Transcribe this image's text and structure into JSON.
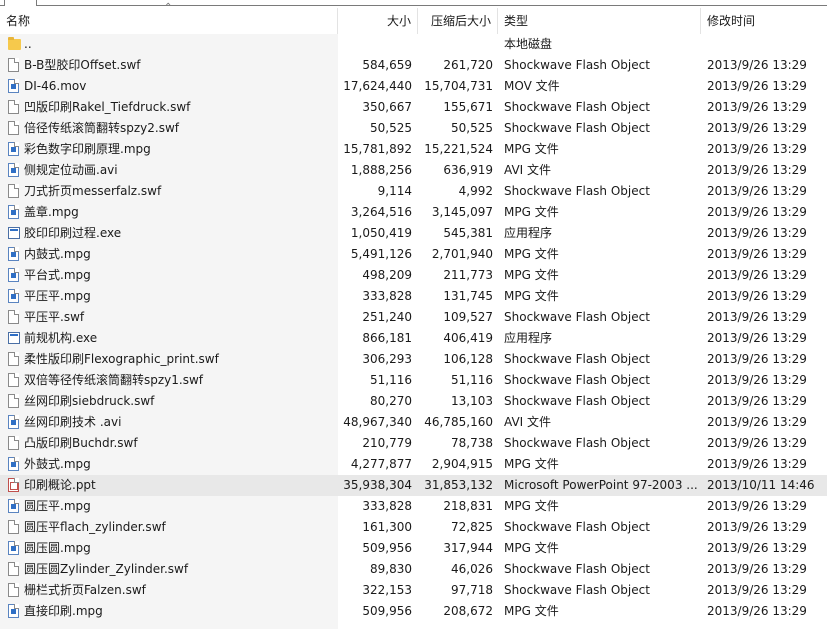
{
  "columns": {
    "name": "名称",
    "size": "大小",
    "compressed": "压缩后大小",
    "type": "类型",
    "modified": "修改时间"
  },
  "rows": [
    {
      "name": "..",
      "size": "",
      "compressed": "",
      "type": "本地磁盘",
      "modified": "",
      "icon": "folder-icon"
    },
    {
      "name": "B-B型胶印Offset.swf",
      "size": "584,659",
      "compressed": "261,720",
      "type": "Shockwave Flash Object",
      "modified": "2013/9/26 13:29",
      "icon": "file-icon"
    },
    {
      "name": "DI-46.mov",
      "size": "17,624,440",
      "compressed": "15,704,731",
      "type": "MOV 文件",
      "modified": "2013/9/26 13:29",
      "icon": "video-file-icon"
    },
    {
      "name": "凹版印刷Rakel_Tiefdruck.swf",
      "size": "350,667",
      "compressed": "155,671",
      "type": "Shockwave Flash Object",
      "modified": "2013/9/26 13:29",
      "icon": "file-icon"
    },
    {
      "name": "倍径传纸滚筒翻转spzy2.swf",
      "size": "50,525",
      "compressed": "50,525",
      "type": "Shockwave Flash Object",
      "modified": "2013/9/26 13:29",
      "icon": "file-icon"
    },
    {
      "name": "彩色数字印刷原理.mpg",
      "size": "15,781,892",
      "compressed": "15,221,524",
      "type": "MPG 文件",
      "modified": "2013/9/26 13:29",
      "icon": "video-file-icon"
    },
    {
      "name": "侧规定位动画.avi",
      "size": "1,888,256",
      "compressed": "636,919",
      "type": "AVI 文件",
      "modified": "2013/9/26 13:29",
      "icon": "video-file-icon"
    },
    {
      "name": "刀式折页messerfalz.swf",
      "size": "9,114",
      "compressed": "4,992",
      "type": "Shockwave Flash Object",
      "modified": "2013/9/26 13:29",
      "icon": "file-icon"
    },
    {
      "name": "盖章.mpg",
      "size": "3,264,516",
      "compressed": "3,145,097",
      "type": "MPG 文件",
      "modified": "2013/9/26 13:29",
      "icon": "video-file-icon"
    },
    {
      "name": "胶印印刷过程.exe",
      "size": "1,050,419",
      "compressed": "545,381",
      "type": "应用程序",
      "modified": "2013/9/26 13:29",
      "icon": "exe-icon"
    },
    {
      "name": "内鼓式.mpg",
      "size": "5,491,126",
      "compressed": "2,701,940",
      "type": "MPG 文件",
      "modified": "2013/9/26 13:29",
      "icon": "video-file-icon"
    },
    {
      "name": "平台式.mpg",
      "size": "498,209",
      "compressed": "211,773",
      "type": "MPG 文件",
      "modified": "2013/9/26 13:29",
      "icon": "video-file-icon"
    },
    {
      "name": "平压平.mpg",
      "size": "333,828",
      "compressed": "131,745",
      "type": "MPG 文件",
      "modified": "2013/9/26 13:29",
      "icon": "video-file-icon"
    },
    {
      "name": "平压平.swf",
      "size": "251,240",
      "compressed": "109,527",
      "type": "Shockwave Flash Object",
      "modified": "2013/9/26 13:29",
      "icon": "file-icon"
    },
    {
      "name": "前规机构.exe",
      "size": "866,181",
      "compressed": "406,419",
      "type": "应用程序",
      "modified": "2013/9/26 13:29",
      "icon": "exe-icon"
    },
    {
      "name": "柔性版印刷Flexographic_print.swf",
      "size": "306,293",
      "compressed": "106,128",
      "type": "Shockwave Flash Object",
      "modified": "2013/9/26 13:29",
      "icon": "file-icon"
    },
    {
      "name": "双倍等径传纸滚筒翻转spzy1.swf",
      "size": "51,116",
      "compressed": "51,116",
      "type": "Shockwave Flash Object",
      "modified": "2013/9/26 13:29",
      "icon": "file-icon"
    },
    {
      "name": "丝网印刷siebdruck.swf",
      "size": "80,270",
      "compressed": "13,103",
      "type": "Shockwave Flash Object",
      "modified": "2013/9/26 13:29",
      "icon": "file-icon"
    },
    {
      "name": "丝网印刷技术 .avi",
      "size": "48,967,340",
      "compressed": "46,785,160",
      "type": "AVI 文件",
      "modified": "2013/9/26 13:29",
      "icon": "video-file-icon"
    },
    {
      "name": "凸版印刷Buchdr.swf",
      "size": "210,779",
      "compressed": "78,738",
      "type": "Shockwave Flash Object",
      "modified": "2013/9/26 13:29",
      "icon": "file-icon"
    },
    {
      "name": "外鼓式.mpg",
      "size": "4,277,877",
      "compressed": "2,904,915",
      "type": "MPG 文件",
      "modified": "2013/9/26 13:29",
      "icon": "video-file-icon"
    },
    {
      "name": "印刷概论.ppt",
      "size": "35,938,304",
      "compressed": "31,853,132",
      "type": "Microsoft PowerPoint 97-2003 ...",
      "modified": "2013/10/11 14:46",
      "icon": "ppt-file-icon",
      "selected": true
    },
    {
      "name": "圆压平.mpg",
      "size": "333,828",
      "compressed": "218,831",
      "type": "MPG 文件",
      "modified": "2013/9/26 13:29",
      "icon": "video-file-icon"
    },
    {
      "name": "圆压平flach_zylinder.swf",
      "size": "161,300",
      "compressed": "72,825",
      "type": "Shockwave Flash Object",
      "modified": "2013/9/26 13:29",
      "icon": "file-icon"
    },
    {
      "name": "圆压圆.mpg",
      "size": "509,956",
      "compressed": "317,944",
      "type": "MPG 文件",
      "modified": "2013/9/26 13:29",
      "icon": "video-file-icon"
    },
    {
      "name": "圆压圆Zylinder_Zylinder.swf",
      "size": "89,830",
      "compressed": "46,026",
      "type": "Shockwave Flash Object",
      "modified": "2013/9/26 13:29",
      "icon": "file-icon"
    },
    {
      "name": "栅栏式折页Falzen.swf",
      "size": "322,153",
      "compressed": "97,718",
      "type": "Shockwave Flash Object",
      "modified": "2013/9/26 13:29",
      "icon": "file-icon"
    },
    {
      "name": "直接印刷.mpg",
      "size": "509,956",
      "compressed": "208,672",
      "type": "MPG 文件",
      "modified": "2013/9/26 13:29",
      "icon": "video-file-icon"
    }
  ]
}
